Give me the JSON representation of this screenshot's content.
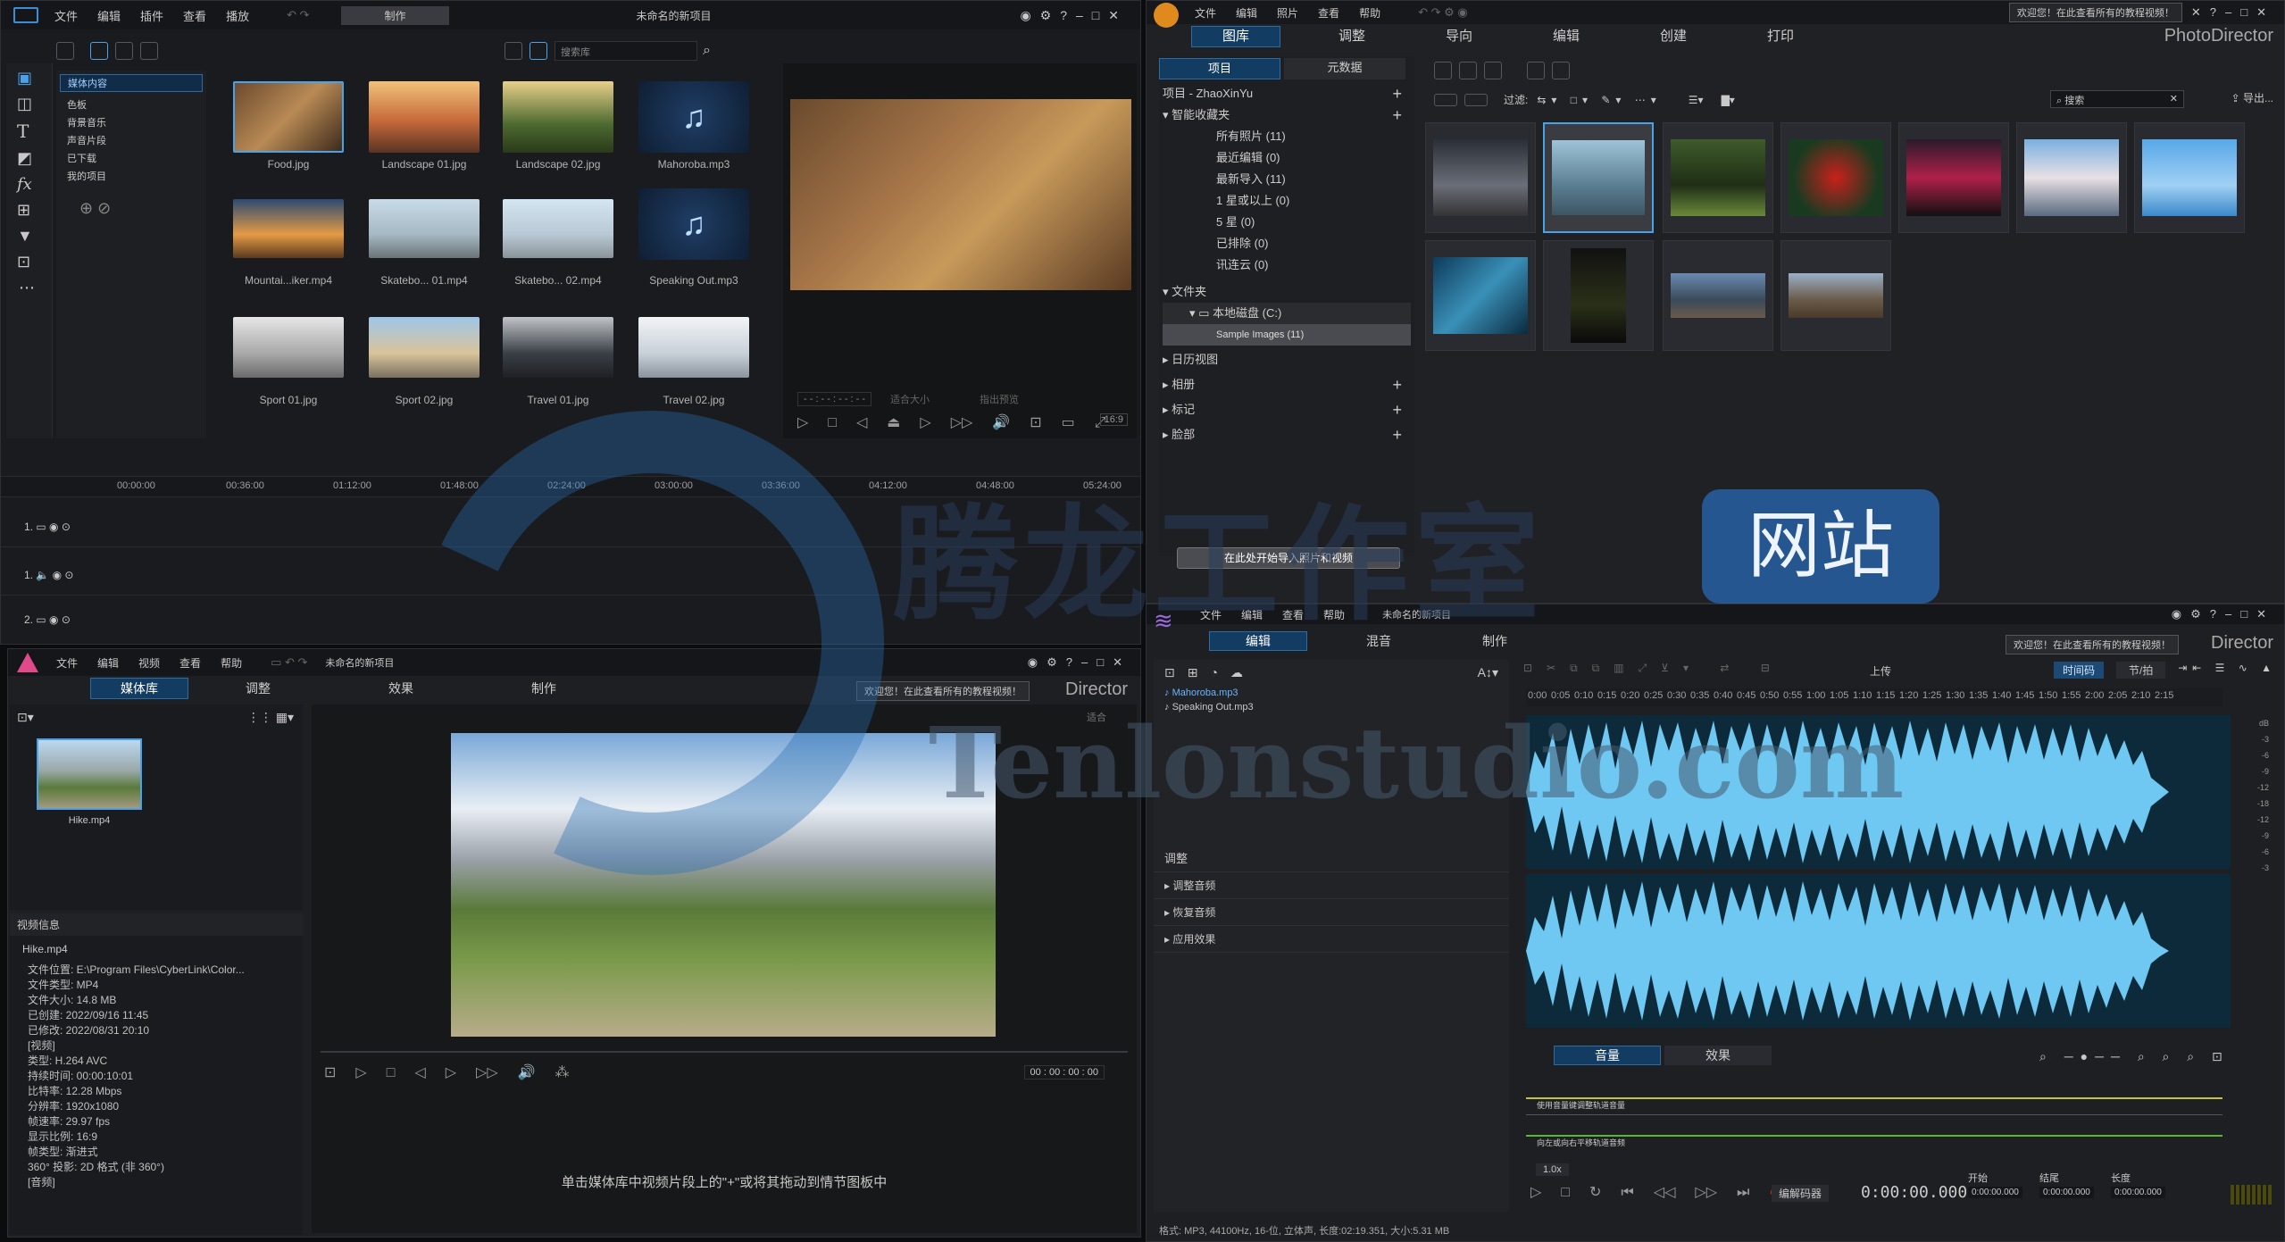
{
  "pd": {
    "menu": [
      "文件",
      "编辑",
      "插件",
      "查看",
      "播放"
    ],
    "produce": "制作",
    "title": "未命名的新项目",
    "left_panel": [
      "媒体内容",
      "色板",
      "背景音乐",
      "声音片段",
      "已下载",
      "我的项目"
    ],
    "search_placeholder": "搜索库",
    "media": [
      "Food.jpg",
      "Landscape 01.jpg",
      "Landscape 02.jpg",
      "Mahoroba.mp3",
      "Mountai...iker.mp4",
      "Skatebo... 01.mp4",
      "Skatebo... 02.mp4",
      "Speaking Out.mp3",
      "Sport 01.jpg",
      "Sport 02.jpg",
      "Travel 01.jpg",
      "Travel 02.jpg"
    ],
    "timecode": "- - : - - : - - : - -",
    "size_label": "适合大小",
    "preview_btn": "指出预览",
    "ratio": "16:9",
    "ruler": [
      "00:00:00",
      "00:36:00",
      "01:12:00",
      "01:48:00",
      "02:24:00",
      "03:00:00",
      "03:36:00",
      "04:12:00",
      "04:48:00",
      "05:24:00"
    ],
    "tracks": [
      "1.",
      "1.",
      "2."
    ]
  },
  "ph": {
    "menu": [
      "文件",
      "编辑",
      "照片",
      "查看",
      "帮助"
    ],
    "tabs": [
      "图库",
      "调整",
      "导向",
      "编辑",
      "创建",
      "打印"
    ],
    "brand": "PhotoDirector",
    "welcome": "欢迎您！在此查看所有的教程视频！",
    "subtabs": [
      "项目",
      "元数据"
    ],
    "project": "项目 - ZhaoXinYu",
    "smart": "智能收藏夹",
    "smart_items": [
      "所有照片 (11)",
      "最近编辑 (0)",
      "最新导入 (11)",
      "1 星或以上 (0)",
      "5 星 (0)",
      "已排除 (0)",
      "讯连云 (0)"
    ],
    "folder": "文件夹",
    "disk": "本地磁盘 (C:)",
    "sample": "Sample Images (11)",
    "calendar": "日历视图",
    "album": "相册",
    "tag": "标记",
    "face": "脸部",
    "filter": "过滤:",
    "search": "搜索",
    "export": "导出...",
    "import_btn": "在此处开始导入照片和视频"
  },
  "pw": {
    "menu": [
      "文件",
      "编辑",
      "视频",
      "查看",
      "帮助"
    ],
    "title": "未命名的新项目",
    "tabs": [
      "媒体库",
      "调整",
      "效果",
      "制作"
    ],
    "welcome": "欢迎您！在此查看所有的教程视频！",
    "brand": "Director",
    "clip": "Hike.mp4",
    "info_title": "视频信息",
    "info_file": "Hike.mp4",
    "info": [
      "文件位置: E:\\Program Files\\CyberLink\\Color...",
      "文件类型: MP4",
      "文件大小: 14.8 MB",
      "已创建: 2022/09/16 11:45",
      "已修改: 2022/08/31 20:10",
      "",
      "[视频]",
      "类型: H.264 AVC",
      "持续时间: 00:00:10:01",
      "比特率: 12.28 Mbps",
      "分辨率: 1920x1080",
      "帧速率: 29.97 fps",
      "显示比例: 16:9",
      "帧类型: 渐进式",
      "360° 投影: 2D 格式 (非 360°)",
      "",
      "[音频]"
    ],
    "fit": "适合",
    "tc": "00 : 00 : 00 : 00",
    "hint": "单击媒体库中视频片段上的\"+\"或将其拖动到情节图板中"
  },
  "ad": {
    "menu": [
      "文件",
      "编辑",
      "查看",
      "帮助"
    ],
    "title": "未命名的新项目",
    "tabs": [
      "编辑",
      "混音",
      "制作"
    ],
    "welcome": "欢迎您！在此查看所有的教程视频！",
    "brand": "Director",
    "files": [
      "Mahoroba.mp3",
      "Speaking Out.mp3"
    ],
    "adjust": "调整",
    "adjust_items": [
      "调整音频",
      "恢复音频",
      "应用效果"
    ],
    "upload": "上传",
    "timecode_btn": "时间码",
    "beat_btn": "节/拍",
    "ruler": [
      "0:00",
      "0:05",
      "0:10",
      "0:15",
      "0:20",
      "0:25",
      "0:30",
      "0:35",
      "0:40",
      "0:45",
      "0:50",
      "0:55",
      "1:00",
      "1:05",
      "1:10",
      "1:15",
      "1:20",
      "1:25",
      "1:30",
      "1:35",
      "1:40",
      "1:45",
      "1:50",
      "1:55",
      "2:00",
      "2:05",
      "2:10",
      "2:15"
    ],
    "db": [
      "dB",
      "-3",
      "-6",
      "-9",
      "-12",
      "-18",
      "-12",
      "-9",
      "-6",
      "-3"
    ],
    "bottom_tabs": [
      "音量",
      "效果"
    ],
    "env1": "使用音量键调整轨道音量",
    "env2": "向左或向右平移轨道音频",
    "speed": "1.0x",
    "tc_mode": "编解码器",
    "time": "0:00:00.000",
    "start": "开始",
    "end": "结尾",
    "length": "长度",
    "t0": "0:00:00.000",
    "status": "格式: MP3, 44100Hz, 16-位, 立体声, 长度:02:19.351, 大小:5.31 MB"
  },
  "watermark": {
    "cn": "腾龙工作室",
    "site": "网站",
    "en": "Tenlonstudio.com"
  }
}
